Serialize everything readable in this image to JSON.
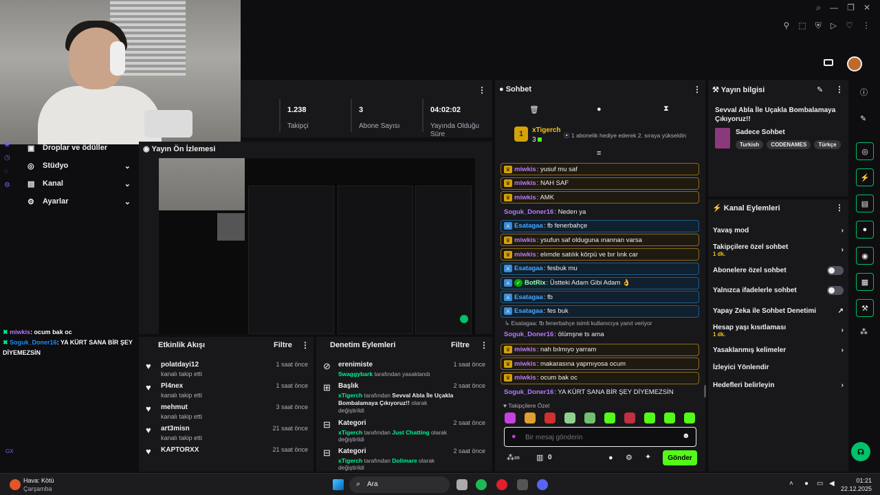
{
  "stats": [
    {
      "value": "1.238",
      "label": "Takipçi"
    },
    {
      "value": "3",
      "label": "Abone Sayısı"
    },
    {
      "value": "04:02:02",
      "label": "Yayında Olduğu Süre"
    }
  ],
  "sidebar": {
    "items": [
      {
        "label": "Droplar ve ödüller"
      },
      {
        "label": "Stüdyo"
      },
      {
        "label": "Kanal"
      },
      {
        "label": "Ayarlar"
      }
    ]
  },
  "preview": {
    "title": "Yayın Ön İzlemesi"
  },
  "overlay_chat": [
    {
      "user": "miwkis",
      "text": ": ocum bak oc",
      "color": "#b779ff"
    },
    {
      "user": "Soguk_Doner16",
      "text": ": YA KÜRT SANA BİR ŞEY DİYEMEZSİN",
      "color": "#1e90ff"
    }
  ],
  "activity": {
    "title": "Etkinlik Akışı",
    "filter": "Filtre",
    "items": [
      {
        "name": "polatdayi12",
        "desc": "kanalı takip etti",
        "time": "1 saat önce"
      },
      {
        "name": "Pl4nex",
        "desc": "kanalı takip etti",
        "time": "1 saat önce"
      },
      {
        "name": "mehmut",
        "desc": "kanalı takip etti",
        "time": "3 saat önce"
      },
      {
        "name": "art3misn",
        "desc": "kanalı takip etti",
        "time": "21 saat önce"
      },
      {
        "name": "KAPTORXX",
        "desc": "",
        "time": "21 saat önce"
      }
    ]
  },
  "moderation": {
    "title": "Denetim Eylemleri",
    "filter": "Filtre",
    "items": [
      {
        "title": "erenimiste",
        "actor": "Swaggybark",
        "pre": " tarafından yasaklandı",
        "mid": "",
        "post": "",
        "time": "1 saat önce"
      },
      {
        "title": "Başlık",
        "actor": "xTigerch",
        "pre": " tarafından ",
        "mid": "Sevval Abla İle Uçakla Bombalamaya Çıkıyoruz!!",
        "post": " olarak değiştirildi",
        "time": "2 saat önce"
      },
      {
        "title": "Kategori",
        "actor": "xTigerch",
        "pre": " tarafından ",
        "mid": "Just Chatting",
        "post": " olarak değiştirildi",
        "time": "2 saat önce"
      },
      {
        "title": "Kategori",
        "actor": "xTigerch",
        "pre": " tarafından ",
        "mid": "Dolimare",
        "post": " olarak değiştirildi",
        "time": "2 saat önce"
      }
    ]
  },
  "chat": {
    "title": "Sohbet",
    "top_user": "xTigerch",
    "top_count": "3",
    "gift_text": "1 abonelik hediye ederek 2. sıraya yükseldin",
    "messages": [
      {
        "style": "sub",
        "badge": "crown",
        "user": "miwkis",
        "color": "#b779ff",
        "text": ": yusuf mu saf"
      },
      {
        "style": "sub",
        "badge": "crown",
        "user": "miwkis",
        "color": "#b779ff",
        "text": ": NAH SAF"
      },
      {
        "style": "sub",
        "badge": "crown",
        "user": "miwkis",
        "color": "#b779ff",
        "text": ": AMK"
      },
      {
        "style": "plain",
        "badge": "",
        "user": "Soguk_Doner16",
        "color": "#b779ff",
        "text": ": Neden ya"
      },
      {
        "style": "mod",
        "badge": "sword",
        "user": "Esatagaa",
        "color": "#4aa8ff",
        "text": ": fb fenerbahçe"
      },
      {
        "style": "sub",
        "badge": "crown",
        "user": "miwkis",
        "color": "#b779ff",
        "text": ": ysufun saf olduguna ınannan varsa"
      },
      {
        "style": "sub",
        "badge": "crown",
        "user": "miwkis",
        "color": "#b779ff",
        "text": ": elımde satılık körpü ve bır lınk car"
      },
      {
        "style": "mod",
        "badge": "sword",
        "user": "Esatagaa",
        "color": "#4aa8ff",
        "text": ": fesbuk mu"
      },
      {
        "style": "mod",
        "badge": "bot",
        "user": "BotRix",
        "color": "#9bffb0",
        "text": ": Üstteki Adam Gibi Adam 👌"
      },
      {
        "style": "mod",
        "badge": "sword",
        "user": "Esatagaa",
        "color": "#4aa8ff",
        "text": ": fb"
      },
      {
        "style": "mod",
        "badge": "sword",
        "user": "Esatagaa",
        "color": "#4aa8ff",
        "text": ": fes buk"
      }
    ],
    "reply_note": "Esatagaa: fb fenerbahçe isimli kullanıcıya yanıt veriyor",
    "reply_msg": {
      "user": "Soguk_Doner16",
      "text": ": ölümşne ts ama"
    },
    "messages2": [
      {
        "style": "sub",
        "user": "miwkis",
        "text": ": nah bılmıyo yarram"
      },
      {
        "style": "sub",
        "user": "miwkis",
        "text": ": makarasına yapmıyosa ocum"
      },
      {
        "style": "sub",
        "user": "miwkis",
        "text": ": ocum bak oc"
      }
    ],
    "last_msg": {
      "user": "Soguk_Doner16",
      "text": ": YA KÜRT SANA BİR ŞEY DİYEMEZSİN"
    },
    "followers_only": "Takipçilere Özel",
    "placeholder": "Bir mesaj gönderin",
    "count_zero": "0",
    "send": "Gönder"
  },
  "stream_info": {
    "title": "Yayın bilgisi",
    "stream_title": "Sevval Abla İle Uçakla Bombalamaya Çıkıyoruz!!",
    "category": "Sadece Sohbet",
    "tags": [
      "Turkish",
      "CODENAMES",
      "Türkçe"
    ]
  },
  "channel_actions": {
    "title": "Kanal Eylemleri",
    "items": [
      {
        "label": "Yavaş mod",
        "sub": "",
        "ctrl": "chev"
      },
      {
        "label": "Takipçilere özel sohbet",
        "sub": "1 dk.",
        "ctrl": "chev"
      },
      {
        "label": "Abonelere özel sohbet",
        "sub": "",
        "ctrl": "toggle"
      },
      {
        "label": "Yalnızca ifadelerle sohbet",
        "sub": "",
        "ctrl": "toggle"
      },
      {
        "label": "Yapay Zeka ile Sohbet Denetimi",
        "sub": "",
        "ctrl": "ext"
      },
      {
        "label": "Hesap yaşı kısıtlaması",
        "sub": "1 dk.",
        "ctrl": "chev"
      },
      {
        "label": "Yasaklanmış kelimeler",
        "sub": "",
        "ctrl": "chev"
      },
      {
        "label": "İzleyici Yönlendir",
        "sub": "",
        "ctrl": "none"
      },
      {
        "label": "Hedefleri belirleyin",
        "sub": "",
        "ctrl": "chev"
      }
    ]
  },
  "taskbar": {
    "weather": "Hava: Kötü",
    "day": "Çarşamba",
    "search": "Ara",
    "time": "01:21",
    "date": "22.12.2025"
  },
  "corner_text": "GX",
  "colors": {
    "accent": "#53fc18",
    "sub_border": "#8f6b1f",
    "mod_border": "#1f5f8f",
    "kick_green": "#00c26a"
  }
}
